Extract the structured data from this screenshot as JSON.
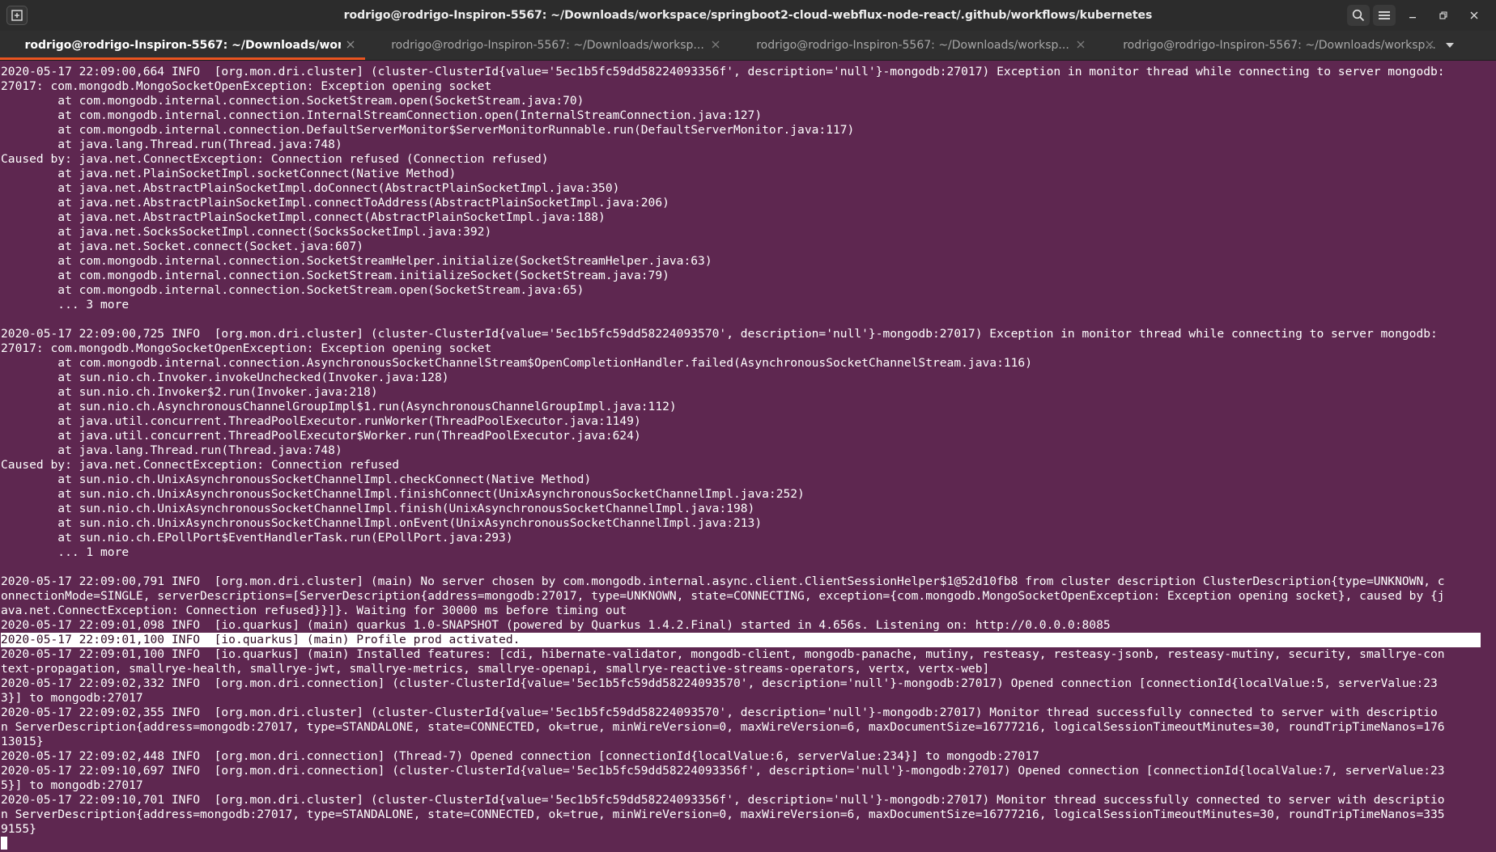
{
  "window": {
    "title": "rodrigo@rodrigo-Inspiron-5567: ~/Downloads/workspace/springboot2-cloud-webflux-node-react/.github/workflows/kubernetes"
  },
  "tabs": [
    {
      "label": "rodrigo@rodrigo-Inspiron-5567: ~/Downloads/worksp..."
    },
    {
      "label": "rodrigo@rodrigo-Inspiron-5567: ~/Downloads/worksp..."
    },
    {
      "label": "rodrigo@rodrigo-Inspiron-5567: ~/Downloads/worksp..."
    },
    {
      "label": "rodrigo@rodrigo-Inspiron-5567: ~/Downloads/worksp..."
    }
  ],
  "icons": {
    "new_tab": "new-tab-icon",
    "search": "search-icon",
    "menu": "hamburger-menu-icon",
    "minimize": "minimize-icon",
    "restore": "restore-icon",
    "close": "close-icon",
    "tab_close": "close-icon",
    "tab_list": "chevron-down-icon"
  },
  "colors": {
    "terminal_bg": "#5e2750",
    "terminal_fg": "#ffffff",
    "accent": "#e95420",
    "titlebar_bg": "#2c2c2c"
  },
  "terminal": {
    "lines": [
      "2020-05-17 22:09:00,664 INFO  [org.mon.dri.cluster] (cluster-ClusterId{value='5ec1b5fc59dd58224093356f', description='null'}-mongodb:27017) Exception in monitor thread while connecting to server mongodb:",
      "27017: com.mongodb.MongoSocketOpenException: Exception opening socket",
      "        at com.mongodb.internal.connection.SocketStream.open(SocketStream.java:70)",
      "        at com.mongodb.internal.connection.InternalStreamConnection.open(InternalStreamConnection.java:127)",
      "        at com.mongodb.internal.connection.DefaultServerMonitor$ServerMonitorRunnable.run(DefaultServerMonitor.java:117)",
      "        at java.lang.Thread.run(Thread.java:748)",
      "Caused by: java.net.ConnectException: Connection refused (Connection refused)",
      "        at java.net.PlainSocketImpl.socketConnect(Native Method)",
      "        at java.net.AbstractPlainSocketImpl.doConnect(AbstractPlainSocketImpl.java:350)",
      "        at java.net.AbstractPlainSocketImpl.connectToAddress(AbstractPlainSocketImpl.java:206)",
      "        at java.net.AbstractPlainSocketImpl.connect(AbstractPlainSocketImpl.java:188)",
      "        at java.net.SocksSocketImpl.connect(SocksSocketImpl.java:392)",
      "        at java.net.Socket.connect(Socket.java:607)",
      "        at com.mongodb.internal.connection.SocketStreamHelper.initialize(SocketStreamHelper.java:63)",
      "        at com.mongodb.internal.connection.SocketStream.initializeSocket(SocketStream.java:79)",
      "        at com.mongodb.internal.connection.SocketStream.open(SocketStream.java:65)",
      "        ... 3 more",
      "",
      "2020-05-17 22:09:00,725 INFO  [org.mon.dri.cluster] (cluster-ClusterId{value='5ec1b5fc59dd58224093570', description='null'}-mongodb:27017) Exception in monitor thread while connecting to server mongodb:",
      "27017: com.mongodb.MongoSocketOpenException: Exception opening socket",
      "        at com.mongodb.internal.connection.AsynchronousSocketChannelStream$OpenCompletionHandler.failed(AsynchronousSocketChannelStream.java:116)",
      "        at sun.nio.ch.Invoker.invokeUnchecked(Invoker.java:128)",
      "        at sun.nio.ch.Invoker$2.run(Invoker.java:218)",
      "        at sun.nio.ch.AsynchronousChannelGroupImpl$1.run(AsynchronousChannelGroupImpl.java:112)",
      "        at java.util.concurrent.ThreadPoolExecutor.runWorker(ThreadPoolExecutor.java:1149)",
      "        at java.util.concurrent.ThreadPoolExecutor$Worker.run(ThreadPoolExecutor.java:624)",
      "        at java.lang.Thread.run(Thread.java:748)",
      "Caused by: java.net.ConnectException: Connection refused",
      "        at sun.nio.ch.UnixAsynchronousSocketChannelImpl.checkConnect(Native Method)",
      "        at sun.nio.ch.UnixAsynchronousSocketChannelImpl.finishConnect(UnixAsynchronousSocketChannelImpl.java:252)",
      "        at sun.nio.ch.UnixAsynchronousSocketChannelImpl.finish(UnixAsynchronousSocketChannelImpl.java:198)",
      "        at sun.nio.ch.UnixAsynchronousSocketChannelImpl.onEvent(UnixAsynchronousSocketChannelImpl.java:213)",
      "        at sun.nio.ch.EPollPort$EventHandlerTask.run(EPollPort.java:293)",
      "        ... 1 more",
      "",
      "2020-05-17 22:09:00,791 INFO  [org.mon.dri.cluster] (main) No server chosen by com.mongodb.internal.async.client.ClientSessionHelper$1@52d10fb8 from cluster description ClusterDescription{type=UNKNOWN, c",
      "onnectionMode=SINGLE, serverDescriptions=[ServerDescription{address=mongodb:27017, type=UNKNOWN, state=CONNECTING, exception={com.mongodb.MongoSocketOpenException: Exception opening socket}, caused by {j",
      "ava.net.ConnectException: Connection refused}}]}. Waiting for 30000 ms before timing out",
      "2020-05-17 22:09:01,098 INFO  [io.quarkus] (main) quarkus 1.0-SNAPSHOT (powered by Quarkus 1.4.2.Final) started in 4.656s. Listening on: http://0.0.0.0:8085",
      "2020-05-17 22:09:01,100 INFO  [io.quarkus] (main) Profile prod activated.",
      "2020-05-17 22:09:01,100 INFO  [io.quarkus] (main) Installed features: [cdi, hibernate-validator, mongodb-client, mongodb-panache, mutiny, resteasy, resteasy-jsonb, resteasy-mutiny, security, smallrye-con",
      "text-propagation, smallrye-health, smallrye-jwt, smallrye-metrics, smallrye-openapi, smallrye-reactive-streams-operators, vertx, vertx-web]",
      "2020-05-17 22:09:02,332 INFO  [org.mon.dri.connection] (cluster-ClusterId{value='5ec1b5fc59dd58224093570', description='null'}-mongodb:27017) Opened connection [connectionId{localValue:5, serverValue:23",
      "3}] to mongodb:27017",
      "2020-05-17 22:09:02,355 INFO  [org.mon.dri.cluster] (cluster-ClusterId{value='5ec1b5fc59dd58224093570', description='null'}-mongodb:27017) Monitor thread successfully connected to server with descriptio",
      "n ServerDescription{address=mongodb:27017, type=STANDALONE, state=CONNECTED, ok=true, minWireVersion=0, maxWireVersion=6, maxDocumentSize=16777216, logicalSessionTimeoutMinutes=30, roundTripTimeNanos=176",
      "13015}",
      "2020-05-17 22:09:02,448 INFO  [org.mon.dri.connection] (Thread-7) Opened connection [connectionId{localValue:6, serverValue:234}] to mongodb:27017",
      "2020-05-17 22:09:10,697 INFO  [org.mon.dri.connection] (cluster-ClusterId{value='5ec1b5fc59dd58224093356f', description='null'}-mongodb:27017) Opened connection [connectionId{localValue:7, serverValue:23",
      "5}] to mongodb:27017",
      "2020-05-17 22:09:10,701 INFO  [org.mon.dri.cluster] (cluster-ClusterId{value='5ec1b5fc59dd58224093356f', description='null'}-mongodb:27017) Monitor thread successfully connected to server with descriptio",
      "n ServerDescription{address=mongodb:27017, type=STANDALONE, state=CONNECTED, ok=true, minWireVersion=0, maxWireVersion=6, maxDocumentSize=16777216, logicalSessionTimeoutMinutes=30, roundTripTimeNanos=335",
      "9155}"
    ],
    "highlighted_line_index": 39
  }
}
